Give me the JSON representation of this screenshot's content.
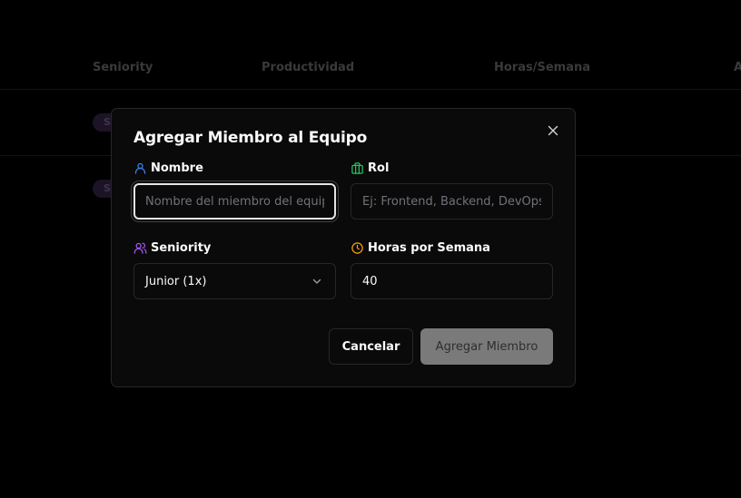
{
  "table": {
    "headers": [
      "Seniority",
      "Productividad",
      "Horas/Semana",
      "A"
    ],
    "row_badges": [
      "S",
      "S"
    ]
  },
  "modal": {
    "title": "Agregar Miembro al Equipo",
    "fields": {
      "nombre": {
        "label": "Nombre",
        "placeholder": "Nombre del miembro del equipo",
        "value": "",
        "icon": "user-icon",
        "icon_color": "#3b82f6"
      },
      "rol": {
        "label": "Rol",
        "placeholder": "Ej: Frontend, Backend, DevOps",
        "value": "",
        "icon": "briefcase-icon",
        "icon_color": "#22c55e"
      },
      "seniority": {
        "label": "Seniority",
        "selected": "Junior (1x)",
        "icon": "users-icon",
        "icon_color": "#a855f7"
      },
      "horas": {
        "label": "Horas por Semana",
        "value": "40",
        "icon": "clock-icon",
        "icon_color": "#f59e0b"
      }
    },
    "buttons": {
      "cancel": "Cancelar",
      "submit": "Agregar Miembro"
    }
  },
  "colors": {
    "background": "#000000",
    "modal_bg": "#0a0a0a",
    "border": "#27272a",
    "text": "#fafafa",
    "submit_disabled_bg": "#7a7a7a"
  }
}
